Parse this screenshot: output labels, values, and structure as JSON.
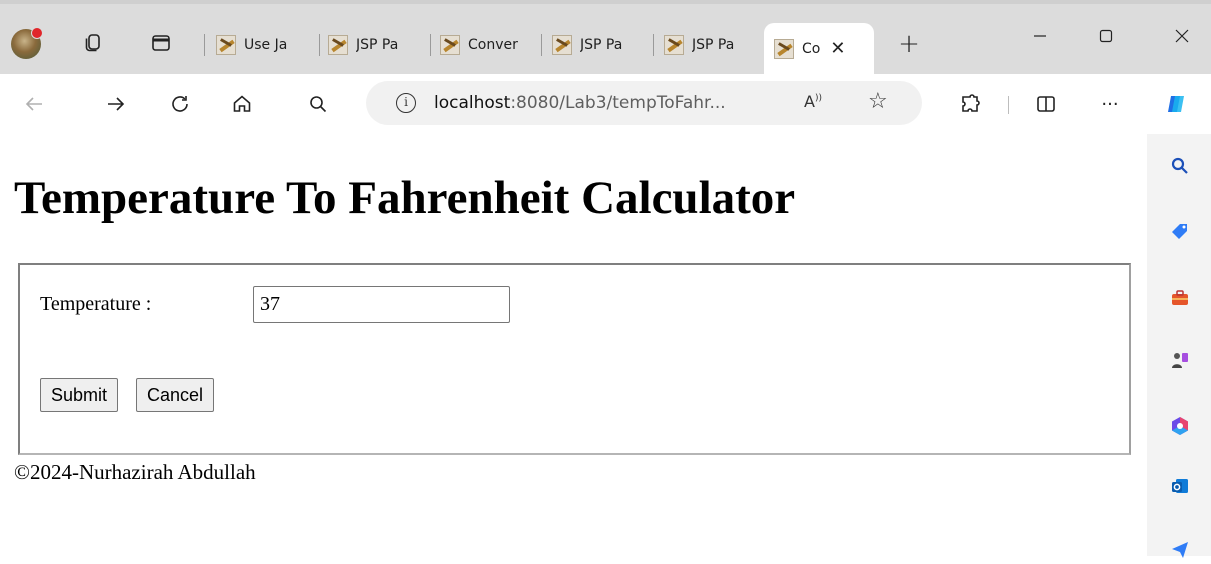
{
  "browser": {
    "tabs": [
      {
        "label": "Use Ja"
      },
      {
        "label": "JSP Pa"
      },
      {
        "label": "Conver"
      },
      {
        "label": "JSP Pa"
      },
      {
        "label": "JSP Pa"
      },
      {
        "label": "Co",
        "active": true
      }
    ],
    "address": {
      "host": "localhost",
      "rest": ":8080/Lab3/tempToFahr..."
    },
    "toolbar_more": "···"
  },
  "page": {
    "heading": "Temperature To Fahrenheit Calculator",
    "form": {
      "temperature_label": "Temperature :",
      "temperature_value": "37",
      "submit_label": "Submit",
      "cancel_label": "Cancel"
    },
    "footer": "©2024-Nurhazirah Abdullah"
  },
  "icons": [
    "profile-avatar",
    "workspaces-icon",
    "tab-actions-icon",
    "new-tab-icon",
    "minimize-icon",
    "maximize-icon",
    "close-window-icon",
    "back-icon",
    "forward-icon",
    "refresh-icon",
    "home-icon",
    "search-icon",
    "info-icon",
    "read-aloud-icon",
    "favorite-icon",
    "extensions-icon",
    "split-screen-icon",
    "more-icon",
    "copilot-icon",
    "sidebar-search-icon",
    "shopping-tag-icon",
    "tools-icon",
    "games-icon",
    "office-icon",
    "outlook-icon",
    "send-icon"
  ]
}
